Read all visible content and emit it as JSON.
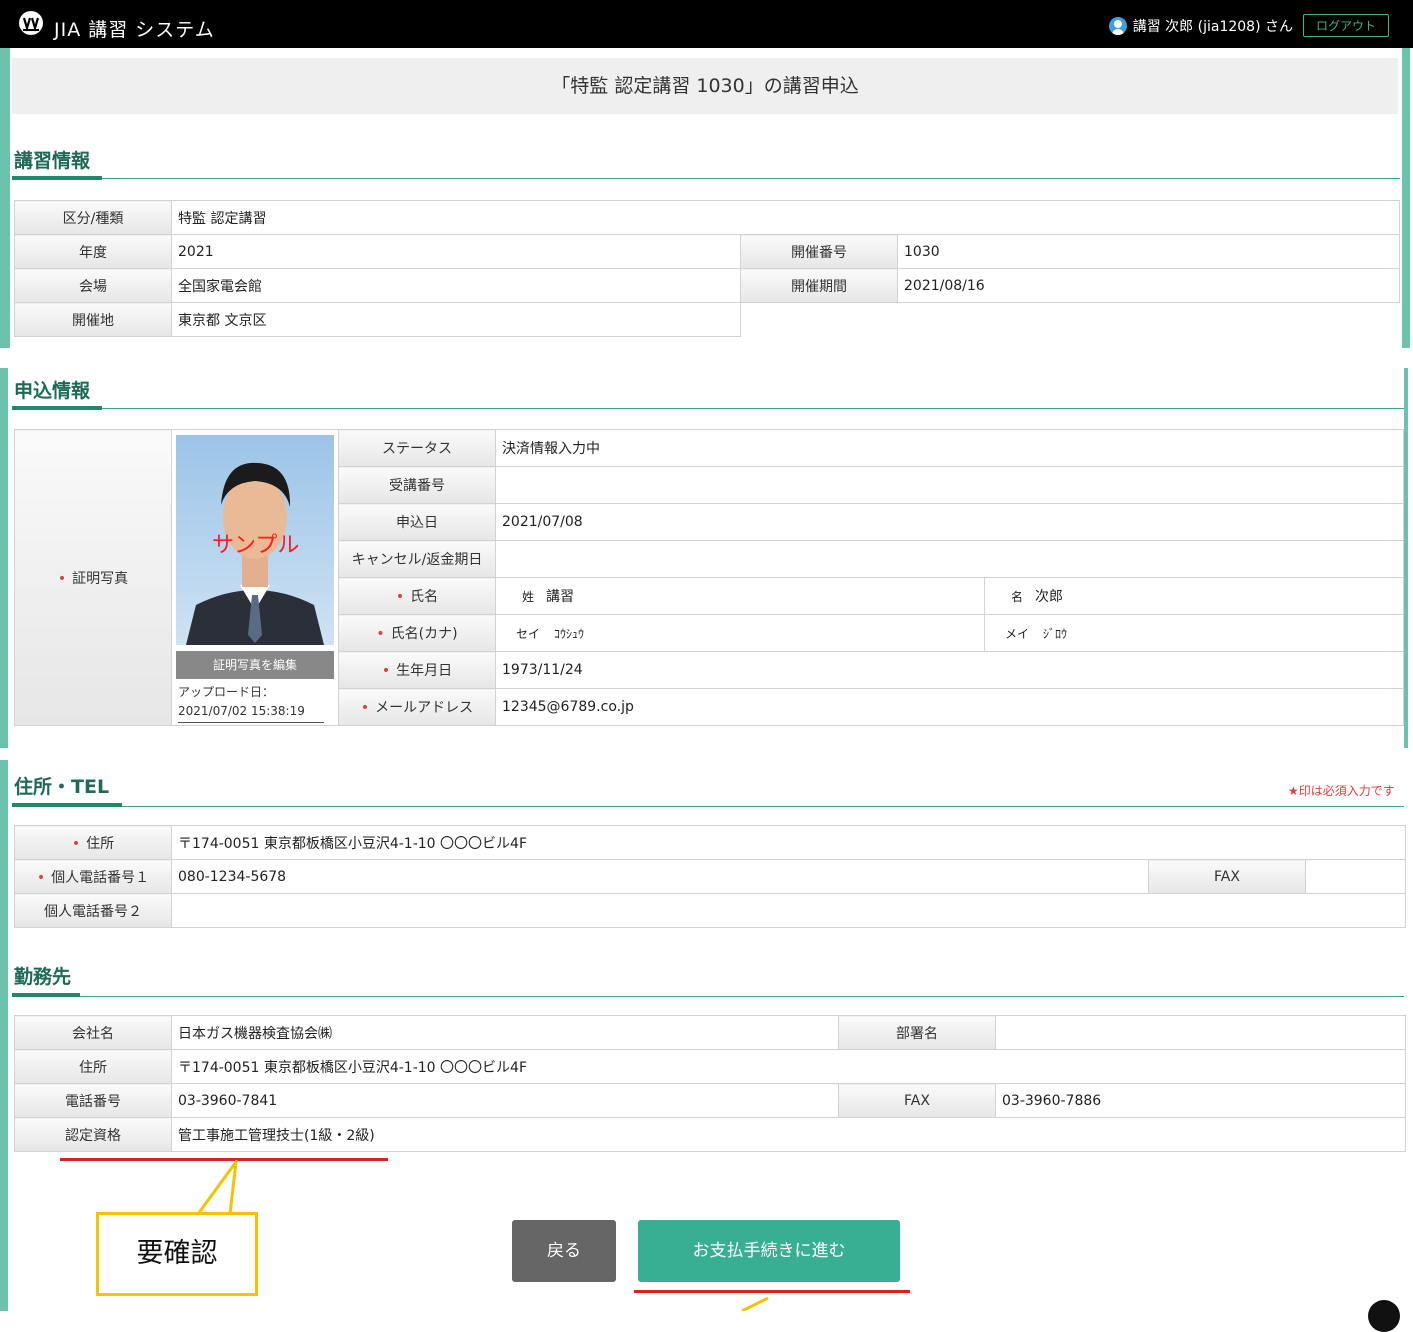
{
  "header": {
    "app_title": "JIA 講習 システム",
    "user_text": "講習 次郎 (jia1208) さん",
    "logout_label": "ログアウト"
  },
  "page_title": "「特監 認定講習 1030」の講習申込",
  "course_section": {
    "title": "講習情報",
    "category_label": "区分/種類",
    "category_value": "特監 認定講習",
    "year_label": "年度",
    "year_value": "2021",
    "session_no_label": "開催番号",
    "session_no_value": "1030",
    "venue_label": "会場",
    "venue_value": "全国家電会館",
    "period_label": "開催期間",
    "period_value": "2021/08/16",
    "location_label": "開催地",
    "location_value": "東京都 文京区"
  },
  "application_section": {
    "title": "申込情報",
    "photo_label": "証明写真",
    "photo_sample_text": "サンプル",
    "edit_photo_label": "証明写真を編集",
    "upload_date_label": "アップロード日：",
    "upload_date_value": "2021/07/02 15:38:19",
    "status_label": "ステータス",
    "status_value": "決済情報入力中",
    "exam_no_label": "受講番号",
    "exam_no_value": "",
    "apply_date_label": "申込日",
    "apply_date_value": "2021/07/08",
    "cancel_label": "キャンセル/返金期日",
    "cancel_value": "",
    "name_label": "氏名",
    "last_name_prefix": "姓",
    "last_name": "講習",
    "first_name_prefix": "名",
    "first_name": "次郎",
    "kana_label": "氏名(カナ)",
    "last_kana_prefix": "セイ",
    "last_kana": "ｺｳｼｭｳ",
    "first_kana_prefix": "メイ",
    "first_kana": "ｼﾞﾛｳ",
    "birth_label": "生年月日",
    "birth_value": "1973/11/24",
    "email_label": "メールアドレス",
    "email_value": "12345@6789.co.jp"
  },
  "address_section": {
    "title": "住所・TEL",
    "required_note": "★印は必須入力です",
    "address_label": "住所",
    "address_value": "〒174-0051 東京都板橋区小豆沢4-1-10 〇〇〇ビル4F",
    "phone1_label": "個人電話番号１",
    "phone1_value": "080-1234-5678",
    "fax_label": "FAX",
    "fax_value": "",
    "phone2_label": "個人電話番号２",
    "phone2_value": ""
  },
  "work_section": {
    "title": "勤務先",
    "company_label": "会社名",
    "company_value": "日本ガス機器検査協会㈱",
    "dept_label": "部署名",
    "dept_value": "",
    "address_label": "住所",
    "address_value": "〒174-0051 東京都板橋区小豆沢4-1-10 〇〇〇ビル4F",
    "phone_label": "電話番号",
    "phone_value": "03-3960-7841",
    "fax_label": "FAX",
    "fax_value": "03-3960-7886",
    "cert_label": "認定資格",
    "cert_value": "管工事施工管理技士(1級・2級)"
  },
  "actions": {
    "back_label": "戻る",
    "pay_label": "お支払手続きに進む"
  },
  "annotation": {
    "callout_text": "要確認"
  }
}
